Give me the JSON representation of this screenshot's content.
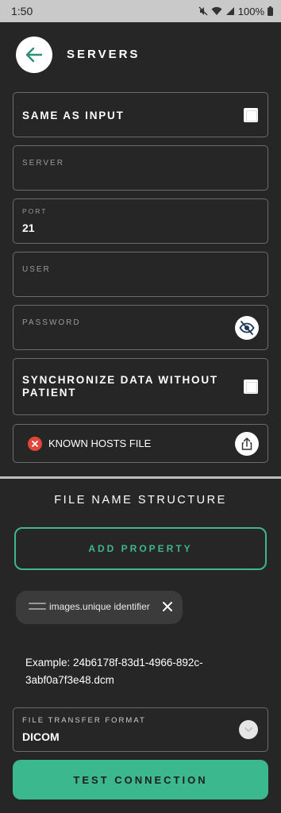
{
  "status_bar": {
    "time": "1:50",
    "battery": "100%",
    "icons": [
      "mute-icon",
      "wifi-icon",
      "signal-icon",
      "battery-icon"
    ]
  },
  "header": {
    "title": "SERVERS",
    "back_icon": "arrow-left-icon"
  },
  "form": {
    "same_as_input": {
      "label": "SAME AS INPUT",
      "checked": false
    },
    "server": {
      "label": "SERVER",
      "value": ""
    },
    "port": {
      "label": "PORT",
      "value": "21"
    },
    "user": {
      "label": "USER",
      "value": ""
    },
    "password": {
      "label": "PASSWORD",
      "value": "",
      "toggle_icon": "eye-off-icon"
    },
    "sync_without_patient": {
      "label": "SYNCHRONIZE DATA WITHOUT PATIENT",
      "checked": false
    },
    "known_hosts": {
      "label": "KNOWN HOSTS FILE",
      "status_icon": "error-x-icon",
      "upload_icon": "upload-icon"
    }
  },
  "file_name_structure": {
    "title": "FILE NAME STRUCTURE",
    "add_property_label": "ADD PROPERTY",
    "properties": [
      {
        "label": "images.unique identifier"
      }
    ],
    "example_text": "Example: 24b6178f-83d1-4966-892c-3abf0a7f3e48.dcm"
  },
  "file_transfer_format": {
    "label": "FILE TRANSFER FORMAT",
    "value": "DICOM",
    "dropdown_icon": "chevron-down-icon"
  },
  "test_connection_label": "TEST CONNECTION",
  "colors": {
    "background": "#262626",
    "accent": "#3cb88e",
    "error": "#e2453a",
    "field_border": "#6c6c6c"
  }
}
